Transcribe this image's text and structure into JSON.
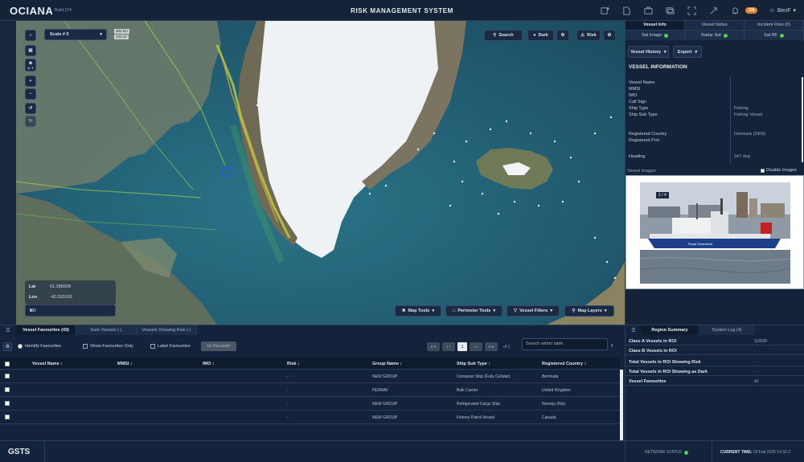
{
  "app": {
    "logo": "OCIANA",
    "build": "Build 174",
    "title": "RISK MANAGEMENT SYSTEM",
    "notification_count": "156",
    "user": "BenF"
  },
  "map": {
    "scale": "Scale # 5",
    "scale_km": "300 km",
    "scale_mi": "100 mi",
    "search": "Search",
    "dark": "Dark",
    "risk": "Risk",
    "lat_label": "Lat",
    "lat_value": "61.385608",
    "lon_label": "Lon",
    "lon_value": "-42.530163",
    "coord_format": "DD",
    "tools": {
      "map_tools": "Map Tools",
      "perimeter_tools": "Perimeter Tools",
      "vessel_filters": "Vessel Filters",
      "map_layers": "Map Layers"
    },
    "left_tools": [
      "home-icon",
      "layers-icon",
      "xy-icon",
      "zoom-in-icon",
      "zoom-out-icon",
      "undo-icon",
      "redo-icon"
    ],
    "xy_label": "X, Y"
  },
  "right_panel": {
    "tabs": [
      "Vessel Info",
      "Vessel Notes",
      "Incident Files (0)"
    ],
    "sat_tabs": [
      "Sat Image",
      "Radar Sat",
      "Sat RF"
    ],
    "vessel_history": "Vessel History",
    "export": "Export",
    "section_title": "VESSEL INFORMATION",
    "fields": [
      {
        "label": "Vessel Name",
        "value": ""
      },
      {
        "label": "MMSI",
        "value": ""
      },
      {
        "label": "IMO",
        "value": ""
      },
      {
        "label": "Call Sign",
        "value": ""
      },
      {
        "label": "Ship Type",
        "value": "Fishing"
      },
      {
        "label": "Ship Sub Type",
        "value": "Fishing Vessel"
      },
      {
        "label": "Registered Country",
        "value": "Denmark (DEN)"
      },
      {
        "label": "Registered Port",
        "value": ""
      },
      {
        "label": "Heading",
        "value": "347 deg"
      }
    ],
    "images_label": "Vessel Images",
    "disable_images": "Disable Images",
    "photo_counter": "1 / 4",
    "hull_text": "Royal Greenland"
  },
  "table_panel": {
    "tabs": [
      "Vessel Favourites (43)",
      "Dark Vessels (-)",
      "Vessels Showing Risk (-)"
    ],
    "identify_favourites": "Identify Favourites",
    "show_favourites_only": "Show Favourites Only",
    "label_favourites": "Label Favourites",
    "unfavourite": "Un-Favourite",
    "pager": {
      "first": "« «",
      "prev": "‹ ‹",
      "current": "1",
      "next": "› ›",
      "last": "» »",
      "of": "of 1"
    },
    "search_placeholder": "Search within table",
    "columns": [
      "Vessel Name ↕",
      "MMSI ↕",
      "IMO ↕",
      "Risk ↕",
      "Group Name ↕",
      "Ship Sub Type ↕",
      "Registered Country ↕"
    ],
    "rows": [
      {
        "name": "",
        "mmsi": "",
        "imo": "",
        "risk": "-",
        "group": "NEW GROUP",
        "subtype": "Container Ship (Fully Cellular)",
        "country": "Bermuda"
      },
      {
        "name": "",
        "mmsi": "",
        "imo": "",
        "risk": "-",
        "group": "FEDNAV",
        "subtype": "Bulk Carrier",
        "country": "United Kingdom"
      },
      {
        "name": "",
        "mmsi": "",
        "imo": "",
        "risk": "-",
        "group": "NEW GROUP",
        "subtype": "Refrigerated Cargo Ship",
        "country": "Norway (Nis)"
      },
      {
        "name": "",
        "mmsi": "",
        "imo": "",
        "risk": "-",
        "group": "NEW GROUP",
        "subtype": "Fishery Patrol Vessel",
        "country": "Canada"
      }
    ]
  },
  "summary_panel": {
    "tabs": [
      "Region Summary",
      "System Log (4)"
    ],
    "rows": [
      {
        "label": "Class A Vessels in ROI",
        "value": "116595"
      },
      {
        "label": "Class B Vessels in ROI",
        "value": "-"
      },
      {
        "label": "Total Vessels in ROI Showing Risk",
        "value": "-"
      },
      {
        "label": "Total Vessels in ROI Showing as Dark",
        "value": "-"
      },
      {
        "label": "Vessel Favourites",
        "value": "43"
      }
    ]
  },
  "footer": {
    "brand": "GSTS",
    "network_status": "NETWORK STATUS",
    "current_time_label": "CURRENT TIME:",
    "current_time": "03 Feb 2025 14:32 Z"
  },
  "colors": {
    "accent": "#4cd24c",
    "notification": "#e8822a",
    "panel": "#14233a"
  }
}
